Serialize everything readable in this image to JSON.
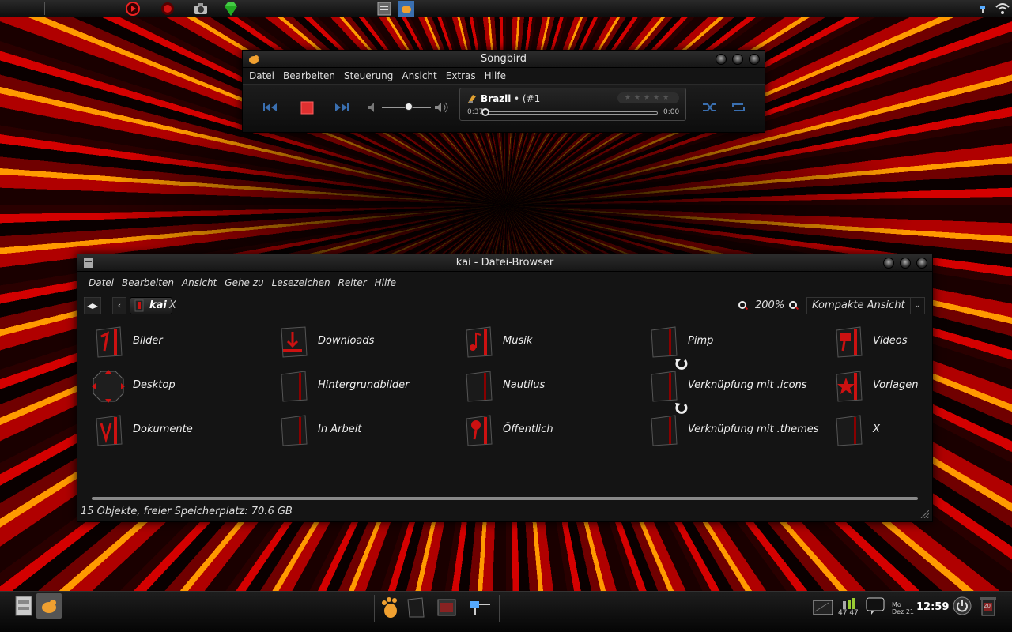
{
  "songbird": {
    "title": "Songbird",
    "menu": [
      "Datei",
      "Bearbeiten",
      "Steuerung",
      "Ansicht",
      "Extras",
      "Hilfe"
    ],
    "track_title": "Brazil",
    "track_number": "(#1",
    "time_elapsed": "0:37",
    "time_total": "0:00",
    "volume_level": 0.55
  },
  "filebrowser": {
    "title": "kai - Datei-Browser",
    "menu": [
      "Datei",
      "Bearbeiten",
      "Ansicht",
      "Gehe zu",
      "Lesezeichen",
      "Reiter",
      "Hilfe"
    ],
    "location": "kai",
    "close_tab": "X",
    "zoom": "200%",
    "view_mode": "Kompakte Ansicht",
    "items": [
      {
        "label": "Bilder",
        "icon": "pictures-folder-icon"
      },
      {
        "label": "Desktop",
        "icon": "desktop-folder-icon"
      },
      {
        "label": "Dokumente",
        "icon": "documents-folder-icon"
      },
      {
        "label": "Downloads",
        "icon": "downloads-folder-icon"
      },
      {
        "label": "Hintergrundbilder",
        "icon": "folder-icon"
      },
      {
        "label": "In Arbeit",
        "icon": "folder-icon"
      },
      {
        "label": "Musik",
        "icon": "music-folder-icon"
      },
      {
        "label": "Nautilus",
        "icon": "folder-icon"
      },
      {
        "label": "Öffentlich",
        "icon": "public-folder-icon"
      },
      {
        "label": "Pimp",
        "icon": "folder-icon"
      },
      {
        "label": "Verknüpfung mit .icons",
        "icon": "folder-link-icon"
      },
      {
        "label": "Verknüpfung mit .themes",
        "icon": "folder-link-icon"
      },
      {
        "label": "Videos",
        "icon": "videos-folder-icon"
      },
      {
        "label": "Vorlagen",
        "icon": "templates-folder-icon"
      },
      {
        "label": "X",
        "icon": "folder-icon"
      }
    ],
    "status": "15 Objekte, freier Speicherplatz: 70.6 GB"
  },
  "bottom_panel": {
    "clock": "12:59",
    "day": "Mo",
    "date": "Dez 21",
    "cpu_values": "47 47",
    "trash_count": "20"
  },
  "colors": {
    "accent_red": "#d01818",
    "player_blue": "#3a6fb0"
  }
}
